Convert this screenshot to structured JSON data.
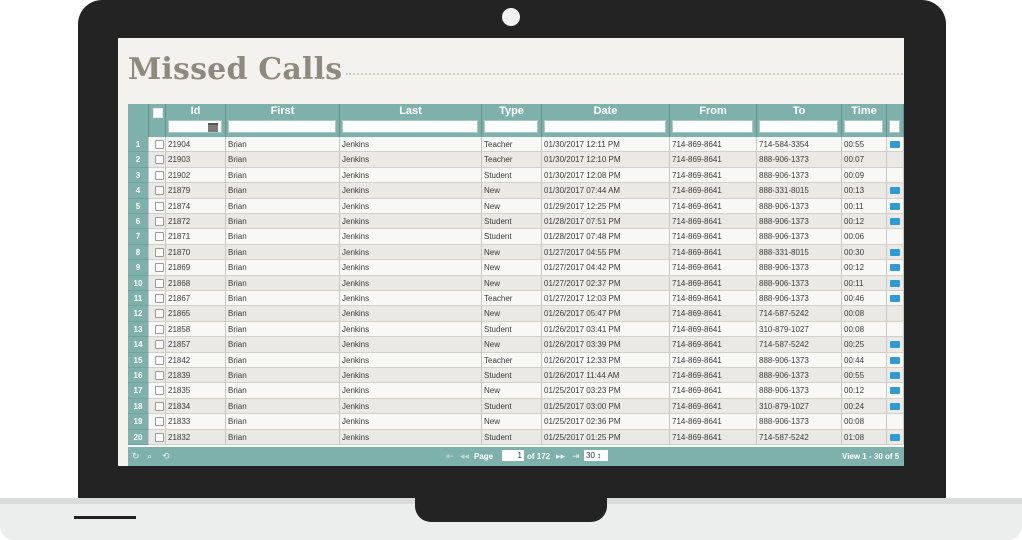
{
  "title": "Missed Calls",
  "columns": [
    "",
    "Id",
    "First",
    "Last",
    "Type",
    "Date",
    "From",
    "To",
    "Time",
    ""
  ],
  "rows": [
    {
      "n": "1",
      "id": "21904",
      "first": "Brian",
      "last": "Jenkins",
      "type": "Teacher",
      "date": "01/30/2017 12:11 PM",
      "from": "714-869-8641",
      "to": "714-584-3354",
      "time": "00:55",
      "play": true
    },
    {
      "n": "2",
      "id": "21903",
      "first": "Brian",
      "last": "Jenkins",
      "type": "Teacher",
      "date": "01/30/2017 12:10 PM",
      "from": "714-869-8641",
      "to": "888-906-1373",
      "time": "00:07",
      "play": false
    },
    {
      "n": "3",
      "id": "21902",
      "first": "Brian",
      "last": "Jenkins",
      "type": "Student",
      "date": "01/30/2017 12:08 PM",
      "from": "714-869-8641",
      "to": "888-906-1373",
      "time": "00:09",
      "play": false
    },
    {
      "n": "4",
      "id": "21879",
      "first": "Brian",
      "last": "Jenkins",
      "type": "New",
      "date": "01/30/2017 07:44 AM",
      "from": "714-869-8641",
      "to": "888-331-8015",
      "time": "00:13",
      "play": true
    },
    {
      "n": "5",
      "id": "21874",
      "first": "Brian",
      "last": "Jenkins",
      "type": "New",
      "date": "01/29/2017 12:25 PM",
      "from": "714-869-8641",
      "to": "888-906-1373",
      "time": "00:11",
      "play": true
    },
    {
      "n": "6",
      "id": "21872",
      "first": "Brian",
      "last": "Jenkins",
      "type": "Student",
      "date": "01/28/2017 07:51 PM",
      "from": "714-869-8641",
      "to": "888-906-1373",
      "time": "00:12",
      "play": true
    },
    {
      "n": "7",
      "id": "21871",
      "first": "Brian",
      "last": "Jenkins",
      "type": "Student",
      "date": "01/28/2017 07:48 PM",
      "from": "714-869-8641",
      "to": "888-906-1373",
      "time": "00:06",
      "play": false
    },
    {
      "n": "8",
      "id": "21870",
      "first": "Brian",
      "last": "Jenkins",
      "type": "New",
      "date": "01/27/2017 04:55 PM",
      "from": "714-869-8641",
      "to": "888-331-8015",
      "time": "00:30",
      "play": true
    },
    {
      "n": "9",
      "id": "21869",
      "first": "Brian",
      "last": "Jenkins",
      "type": "New",
      "date": "01/27/2017 04:42 PM",
      "from": "714-869-8641",
      "to": "888-906-1373",
      "time": "00:12",
      "play": true
    },
    {
      "n": "10",
      "id": "21868",
      "first": "Brian",
      "last": "Jenkins",
      "type": "New",
      "date": "01/27/2017 02:37 PM",
      "from": "714-869-8641",
      "to": "888-906-1373",
      "time": "00:11",
      "play": true
    },
    {
      "n": "11",
      "id": "21867",
      "first": "Brian",
      "last": "Jenkins",
      "type": "Teacher",
      "date": "01/27/2017 12:03 PM",
      "from": "714-869-8641",
      "to": "888-906-1373",
      "time": "00:46",
      "play": true
    },
    {
      "n": "12",
      "id": "21865",
      "first": "Brian",
      "last": "Jenkins",
      "type": "New",
      "date": "01/26/2017 05:47 PM",
      "from": "714-869-8641",
      "to": "714-587-5242",
      "time": "00:08",
      "play": false
    },
    {
      "n": "13",
      "id": "21858",
      "first": "Brian",
      "last": "Jenkins",
      "type": "Student",
      "date": "01/26/2017 03:41 PM",
      "from": "714-869-8641",
      "to": "310-879-1027",
      "time": "00:08",
      "play": false
    },
    {
      "n": "14",
      "id": "21857",
      "first": "Brian",
      "last": "Jenkins",
      "type": "New",
      "date": "01/26/2017 03:39 PM",
      "from": "714-869-8641",
      "to": "714-587-5242",
      "time": "00:25",
      "play": true
    },
    {
      "n": "15",
      "id": "21842",
      "first": "Brian",
      "last": "Jenkins",
      "type": "Teacher",
      "date": "01/26/2017 12:33 PM",
      "from": "714-869-8641",
      "to": "888-906-1373",
      "time": "00:44",
      "play": true
    },
    {
      "n": "16",
      "id": "21839",
      "first": "Brian",
      "last": "Jenkins",
      "type": "Student",
      "date": "01/26/2017 11:44 AM",
      "from": "714-869-8641",
      "to": "888-906-1373",
      "time": "00:55",
      "play": true
    },
    {
      "n": "17",
      "id": "21835",
      "first": "Brian",
      "last": "Jenkins",
      "type": "New",
      "date": "01/25/2017 03:23 PM",
      "from": "714-869-8641",
      "to": "888-906-1373",
      "time": "00:12",
      "play": true
    },
    {
      "n": "18",
      "id": "21834",
      "first": "Brian",
      "last": "Jenkins",
      "type": "Student",
      "date": "01/25/2017 03:00 PM",
      "from": "714-869-8641",
      "to": "310-879-1027",
      "time": "00:24",
      "play": true
    },
    {
      "n": "19",
      "id": "21833",
      "first": "Brian",
      "last": "Jenkins",
      "type": "New",
      "date": "01/25/2017 02:36 PM",
      "from": "714-869-8641",
      "to": "888-906-1373",
      "time": "00:08",
      "play": false
    },
    {
      "n": "20",
      "id": "21832",
      "first": "Brian",
      "last": "Jenkins",
      "type": "Student",
      "date": "01/25/2017 01:25 PM",
      "from": "714-869-8641",
      "to": "714-587-5242",
      "time": "01:08",
      "play": true
    }
  ],
  "pager": {
    "page_label": "Page",
    "page_value": "1",
    "of_label": "of 172",
    "rows_per_page": "30",
    "view_text": "View 1 - 30 of 5"
  },
  "colors": {
    "accent": "#7fb1ac",
    "play_icon": "#2f9bd6",
    "bezel": "#232323"
  }
}
